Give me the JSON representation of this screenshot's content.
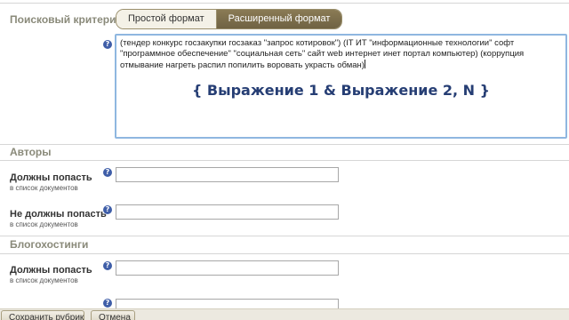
{
  "search_criterion": {
    "label": "Поисковый критерий",
    "format_tabs": [
      {
        "label": "Простой формат",
        "active": false
      },
      {
        "label": "Расширенный формат",
        "active": true
      }
    ],
    "query_text": "(тендер конкурс госзакупки госзаказ \"запрос котировок\")  (IT ИТ \"информационные технологии\" софт \"программное обеспечение\" \"социальная сеть\" сайт web интернет инет портал компьютер)  (коррупция отмывание нагреть распил попилить воровать украсть обман)",
    "overlay_caption": "{ Выражение 1 & Выражение 2, N }"
  },
  "authors": {
    "title": "Авторы",
    "must_include_label": "Должны попасть",
    "must_include_sub": "в список документов",
    "must_include_value": "",
    "must_exclude_label": "Не должны попасть",
    "must_exclude_sub": "в список документов",
    "must_exclude_value": ""
  },
  "blog_hostings": {
    "title": "Блогохостинги",
    "must_include_label": "Должны попасть",
    "must_include_sub": "в список документов",
    "must_include_value": "",
    "must_exclude_value": ""
  },
  "help_glyph": "?",
  "bottom_buttons": {
    "save_label": "Сохранить рубрику",
    "cancel_label": "Отмена"
  },
  "colors": {
    "active_tab": "#7c6e4c",
    "caption": "#263e74",
    "section_title": "#8a8a7a",
    "focus_border": "#8fb7e0"
  }
}
